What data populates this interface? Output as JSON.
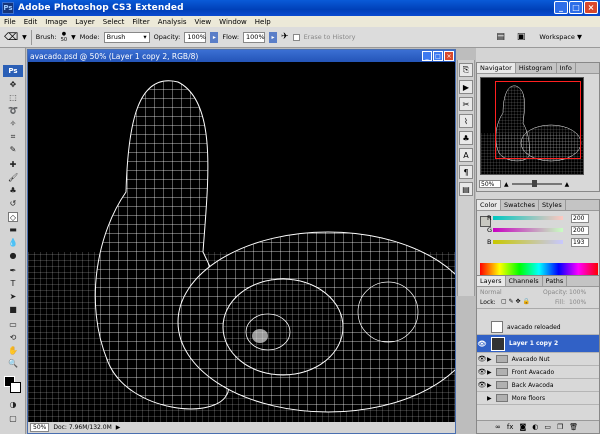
{
  "app": {
    "title": "Adobe Photoshop CS3 Extended",
    "logo": "Ps",
    "window_buttons": [
      "_",
      "□",
      "×"
    ]
  },
  "menu": [
    "File",
    "Edit",
    "Image",
    "Layer",
    "Select",
    "Filter",
    "Analysis",
    "View",
    "Window",
    "Help"
  ],
  "options_bar": {
    "brush_label": "Brush:",
    "brush_size": "50",
    "mode_label": "Mode:",
    "mode_value": "Brush",
    "opacity_label": "Opacity:",
    "opacity_value": "100%",
    "flow_label": "Flow:",
    "flow_value": "100%",
    "erase_history": "Erase to History",
    "workspace_label": "Workspace ▼"
  },
  "document": {
    "title": "avacado.psd @ 50% (Layer 1 copy 2, RGB/8)",
    "status_zoom": "50%",
    "status_doc": "Doc: 7.96M/132.0M"
  },
  "navigator": {
    "tabs": [
      "Navigator",
      "Histogram",
      "Info"
    ],
    "zoom": "50%"
  },
  "color": {
    "tabs": [
      "Color",
      "Swatches",
      "Styles"
    ],
    "r_label": "R",
    "r_value": "200",
    "g_label": "G",
    "g_value": "200",
    "b_label": "B",
    "b_value": "193"
  },
  "layers": {
    "tabs": [
      "Layers",
      "Channels",
      "Paths"
    ],
    "blend_mode": "Normal",
    "opacity_label": "Opacity:",
    "opacity_value": "100%",
    "lock_label": "Lock:",
    "fill_label": "Fill:",
    "fill_value": "100%",
    "rows": [
      {
        "name": "avacado reloaded"
      },
      {
        "name": "Layer 1 copy 2"
      },
      {
        "name": "Avacado Nut"
      },
      {
        "name": "Front Avacado"
      },
      {
        "name": "Back Avacoda"
      },
      {
        "name": "More floors"
      }
    ]
  }
}
